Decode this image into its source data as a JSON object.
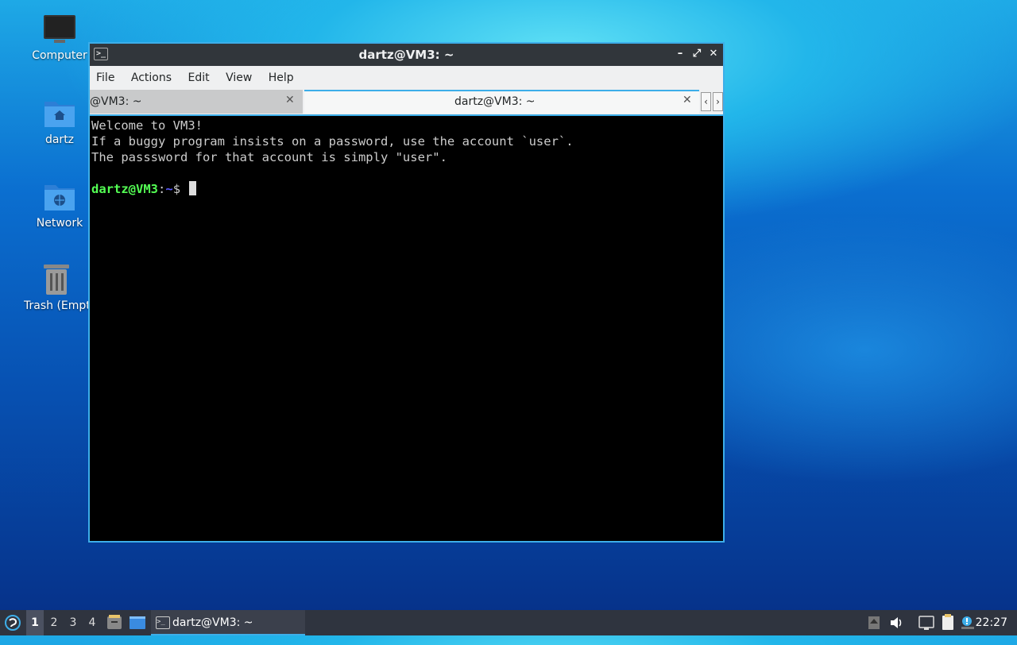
{
  "desktop": {
    "icons": [
      {
        "label": "Computer",
        "icon": "computer-icon"
      },
      {
        "label": "dartz",
        "icon": "home-folder-icon"
      },
      {
        "label": "Network",
        "icon": "network-folder-icon"
      },
      {
        "label": "Trash (Empty)",
        "icon": "trash-icon"
      }
    ]
  },
  "window": {
    "title": "dartz@VM3: ~",
    "buttons": {
      "minimize": "–",
      "maximize": "⤢",
      "close": "✕"
    },
    "menu": [
      "File",
      "Actions",
      "Edit",
      "View",
      "Help"
    ],
    "tabs": [
      {
        "label": "@VM3: ~",
        "close": "✕",
        "active": false
      },
      {
        "label": "dartz@VM3: ~",
        "close": "✕",
        "active": true
      }
    ],
    "tab_scroll": {
      "left": "‹",
      "right": "›"
    }
  },
  "terminal": {
    "lines": [
      "Welcome to VM3!",
      "If a buggy program insists on a password, use the account `user`.",
      "The passsword for that account is simply \"user\".",
      ""
    ],
    "prompt": {
      "user_host": "dartz@VM3",
      "colon": ":",
      "path": "~",
      "symbol": "$ "
    }
  },
  "taskbar": {
    "workspaces": [
      "1",
      "2",
      "3",
      "4"
    ],
    "active_workspace": "1",
    "task_label": "dartz@VM3: ~",
    "clock": "22:27"
  },
  "colors": {
    "accent": "#3daee9",
    "titlebar": "#31363b",
    "prompt_green": "#54ff54",
    "prompt_blue": "#5c5cff"
  }
}
